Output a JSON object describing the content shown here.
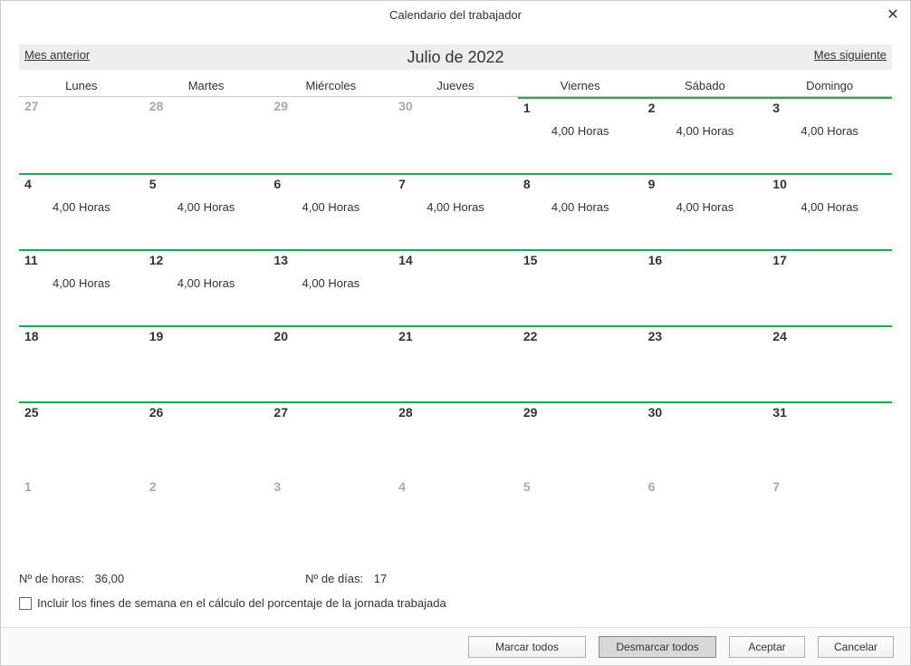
{
  "window": {
    "title": "Calendario del trabajador"
  },
  "nav": {
    "prev": "Mes anterior",
    "label": "Julio de 2022",
    "next": "Mes siguiente"
  },
  "dow": [
    "Lunes",
    "Martes",
    "Miércoles",
    "Jueves",
    "Viernes",
    "Sábado",
    "Domingo"
  ],
  "cells": [
    {
      "n": "27",
      "other": true,
      "active": false,
      "hours": ""
    },
    {
      "n": "28",
      "other": true,
      "active": false,
      "hours": ""
    },
    {
      "n": "29",
      "other": true,
      "active": false,
      "hours": ""
    },
    {
      "n": "30",
      "other": true,
      "active": false,
      "hours": ""
    },
    {
      "n": "1",
      "other": false,
      "active": true,
      "hours": "4,00 Horas"
    },
    {
      "n": "2",
      "other": false,
      "active": true,
      "hours": "4,00 Horas"
    },
    {
      "n": "3",
      "other": false,
      "active": true,
      "hours": "4,00 Horas"
    },
    {
      "n": "4",
      "other": false,
      "active": true,
      "hours": "4,00 Horas"
    },
    {
      "n": "5",
      "other": false,
      "active": true,
      "hours": "4,00 Horas"
    },
    {
      "n": "6",
      "other": false,
      "active": true,
      "hours": "4,00 Horas"
    },
    {
      "n": "7",
      "other": false,
      "active": true,
      "hours": "4,00 Horas"
    },
    {
      "n": "8",
      "other": false,
      "active": true,
      "hours": "4,00 Horas"
    },
    {
      "n": "9",
      "other": false,
      "active": true,
      "hours": "4,00 Horas"
    },
    {
      "n": "10",
      "other": false,
      "active": true,
      "hours": "4,00 Horas"
    },
    {
      "n": "11",
      "other": false,
      "active": true,
      "hours": "4,00 Horas"
    },
    {
      "n": "12",
      "other": false,
      "active": true,
      "hours": "4,00 Horas"
    },
    {
      "n": "13",
      "other": false,
      "active": true,
      "hours": "4,00 Horas"
    },
    {
      "n": "14",
      "other": false,
      "active": true,
      "hours": ""
    },
    {
      "n": "15",
      "other": false,
      "active": true,
      "hours": ""
    },
    {
      "n": "16",
      "other": false,
      "active": true,
      "hours": ""
    },
    {
      "n": "17",
      "other": false,
      "active": true,
      "hours": ""
    },
    {
      "n": "18",
      "other": false,
      "active": true,
      "hours": ""
    },
    {
      "n": "19",
      "other": false,
      "active": true,
      "hours": ""
    },
    {
      "n": "20",
      "other": false,
      "active": true,
      "hours": ""
    },
    {
      "n": "21",
      "other": false,
      "active": true,
      "hours": ""
    },
    {
      "n": "22",
      "other": false,
      "active": true,
      "hours": ""
    },
    {
      "n": "23",
      "other": false,
      "active": true,
      "hours": ""
    },
    {
      "n": "24",
      "other": false,
      "active": true,
      "hours": ""
    },
    {
      "n": "25",
      "other": false,
      "active": true,
      "hours": ""
    },
    {
      "n": "26",
      "other": false,
      "active": true,
      "hours": ""
    },
    {
      "n": "27",
      "other": false,
      "active": true,
      "hours": ""
    },
    {
      "n": "28",
      "other": false,
      "active": true,
      "hours": ""
    },
    {
      "n": "29",
      "other": false,
      "active": true,
      "hours": ""
    },
    {
      "n": "30",
      "other": false,
      "active": true,
      "hours": ""
    },
    {
      "n": "31",
      "other": false,
      "active": true,
      "hours": ""
    },
    {
      "n": "1",
      "other": true,
      "active": false,
      "hours": ""
    },
    {
      "n": "2",
      "other": true,
      "active": false,
      "hours": ""
    },
    {
      "n": "3",
      "other": true,
      "active": false,
      "hours": ""
    },
    {
      "n": "4",
      "other": true,
      "active": false,
      "hours": ""
    },
    {
      "n": "5",
      "other": true,
      "active": false,
      "hours": ""
    },
    {
      "n": "6",
      "other": true,
      "active": false,
      "hours": ""
    },
    {
      "n": "7",
      "other": true,
      "active": false,
      "hours": ""
    }
  ],
  "summary": {
    "hours_label": "Nº de horas:",
    "hours_value": "36,00",
    "days_label": "Nº de días:",
    "days_value": "17"
  },
  "checkbox": {
    "label": "Incluir los fines de semana en el cálculo del porcentaje de la jornada trabajada"
  },
  "buttons": {
    "mark_all": "Marcar todos",
    "unmark_all": "Desmarcar todos",
    "accept": "Aceptar",
    "cancel": "Cancelar"
  }
}
